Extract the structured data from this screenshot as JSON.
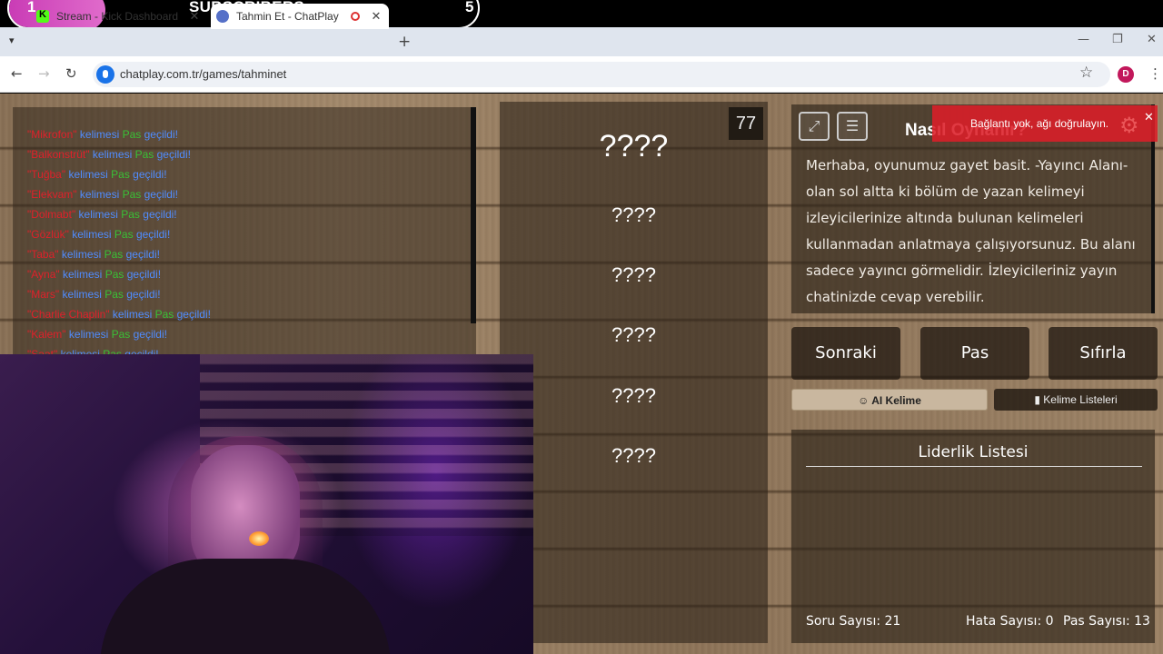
{
  "overlay": {
    "left_count": "1",
    "label": "SUBSCRIBERS",
    "right_count": "5"
  },
  "browser": {
    "tabs": [
      {
        "title": "Stream - Kick Dashboard"
      },
      {
        "title": "Tahmin Et - ChatPlay"
      }
    ],
    "url": "chatplay.com.tr/games/tahminet",
    "avatar": "D"
  },
  "chat_log": [
    {
      "word": "\"Mikrofon\"",
      "kelimesi": "kelimesi",
      "pas": "Pas",
      "gecildi": "geçildi!"
    },
    {
      "word": "\"Balkonstrüt\"",
      "kelimesi": "kelimesi",
      "pas": "Pas",
      "gecildi": "geçildi!"
    },
    {
      "word": "\"Tuğba\"",
      "kelimesi": "kelimesi",
      "pas": "Pas",
      "gecildi": "geçildi!"
    },
    {
      "word": "\"Elekvam\"",
      "kelimesi": "kelimesi",
      "pas": "Pas",
      "gecildi": "geçildi!"
    },
    {
      "word": "\"Dolmabt\"",
      "kelimesi": "kelimesi",
      "pas": "Pas",
      "gecildi": "geçildi!"
    },
    {
      "word": "\"Gözlük\"",
      "kelimesi": "kelimesi",
      "pas": "Pas",
      "gecildi": "geçildi!"
    },
    {
      "word": "\"Taba\"",
      "kelimesi": "kelimesi",
      "pas": "Pas",
      "gecildi": "geçildi!"
    },
    {
      "word": "\"Ayna\"",
      "kelimesi": "kelimesi",
      "pas": "Pas",
      "gecildi": "geçildi!"
    },
    {
      "word": "\"Mars\"",
      "kelimesi": "kelimesi",
      "pas": "Pas",
      "gecildi": "geçildi!"
    },
    {
      "word": "\"Charlie Chaplin\"",
      "kelimesi": "kelimesi",
      "pas": "Pas",
      "gecildi": "geçildi!"
    },
    {
      "word": "\"Kalem\"",
      "kelimesi": "kelimesi",
      "pas": "Pas",
      "gecildi": "geçildi!"
    },
    {
      "word": "\"Saat\"",
      "kelimesi": "kelimesi",
      "pas": "Pas",
      "gecildi": "geçildi!"
    }
  ],
  "game": {
    "timer": "77",
    "main_word": "????",
    "forbidden_words": [
      "????",
      "????",
      "????",
      "????",
      "????"
    ]
  },
  "info": {
    "title": "Nasıl Oynanır?",
    "body": "Merhaba, oyunumuz gayet basit. -Yayıncı Alanı- olan sol altta ki bölüm de yazan kelimeyi izleyicilerinize altında bulunan kelimeleri kullanmadan anlatmaya çalışıyorsunuz. Bu alanı sadece yayıncı görmelidir. İzleyicileriniz yayın chatinizde cevap verebilir.",
    "toast": "Bağlantı yok, ağı doğrulayın."
  },
  "actions": {
    "next": "Sonraki",
    "pass": "Pas",
    "reset": "Sıfırla"
  },
  "tabs": {
    "ai": "AI Kelime",
    "lists": "Kelime Listeleri"
  },
  "leaderboard": {
    "title": "Liderlik Listesi",
    "questions": "Soru Sayısı: 21",
    "errors": "Hata Sayısı: 0",
    "passes": "Pas Sayısı: 13"
  }
}
